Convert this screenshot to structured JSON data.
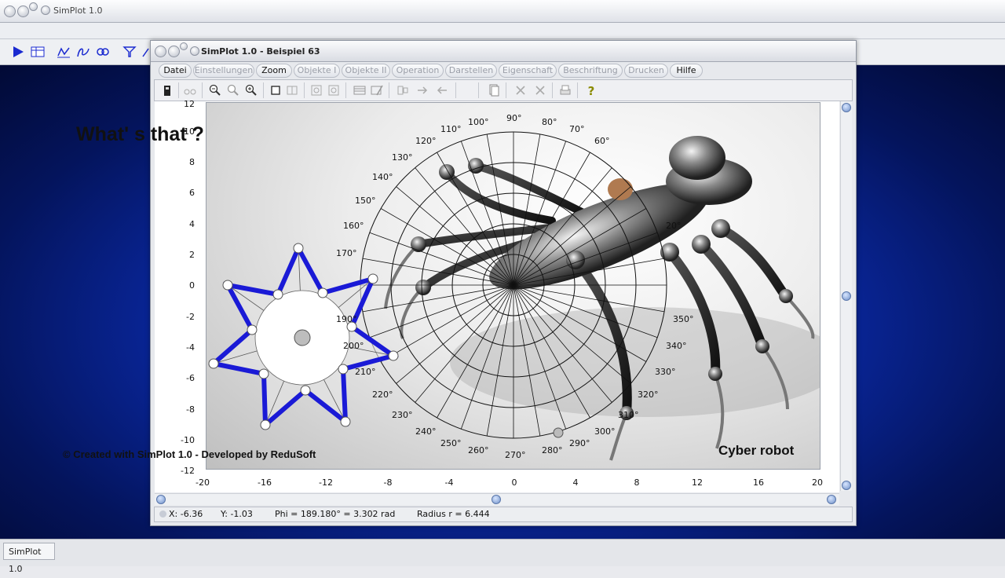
{
  "app": {
    "title": "SimPlot 1.0",
    "taskbar_label": "SimPlot 1.0"
  },
  "window": {
    "title": "SimPlot 1.0 - Beispiel 63"
  },
  "menu": [
    {
      "label": "Datei",
      "enabled": true
    },
    {
      "label": "Einstellungen",
      "enabled": false
    },
    {
      "label": "Zoom",
      "enabled": true
    },
    {
      "label": "Objekte I",
      "enabled": false
    },
    {
      "label": "Objekte II",
      "enabled": false
    },
    {
      "label": "Operation",
      "enabled": false
    },
    {
      "label": "Darstellen",
      "enabled": false
    },
    {
      "label": "Eigenschaft",
      "enabled": false
    },
    {
      "label": "Beschriftung",
      "enabled": false
    },
    {
      "label": "Drucken",
      "enabled": false
    },
    {
      "label": "Hilfe",
      "enabled": true
    }
  ],
  "plot": {
    "headline": "What' s that ?",
    "credit": "© Created with SimPlot 1.0 - Developed by ReduSoft",
    "caption": "Cyber robot",
    "y_ticks": [
      "12",
      "10",
      "8",
      "6",
      "4",
      "2",
      "0",
      "-2",
      "-4",
      "-6",
      "-8",
      "-10",
      "-12"
    ],
    "x_ticks": [
      "-20",
      "-16",
      "-12",
      "-8",
      "-4",
      "0",
      "4",
      "8",
      "12",
      "16",
      "20"
    ],
    "polar_labels": [
      "90°",
      "80°",
      "70°",
      "60°",
      "100°",
      "110°",
      "120°",
      "130°",
      "140°",
      "150°",
      "160°",
      "170°",
      "190°",
      "200°",
      "210°",
      "220°",
      "230°",
      "240°",
      "250°",
      "260°",
      "270°",
      "280°",
      "290°",
      "300°",
      "310°",
      "320°",
      "330°",
      "340°",
      "350°",
      "20°"
    ]
  },
  "status": {
    "x": "X: -6.36",
    "y": "Y: -1.03",
    "phi": "Phi = 189.180° = 3.302 rad",
    "radius": "Radius r = 6.444"
  },
  "colors": {
    "star_stroke": "#1a1ad6",
    "desktop": "#0a2aa8"
  }
}
